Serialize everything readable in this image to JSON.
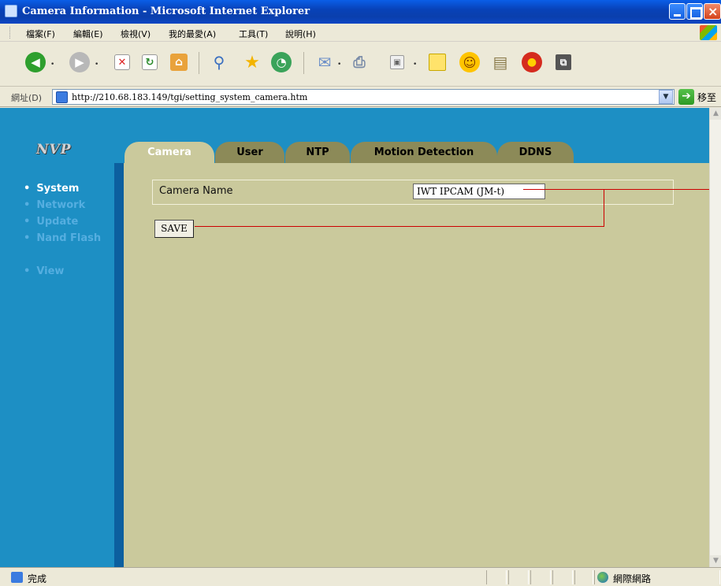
{
  "window": {
    "title": "Camera Information - Microsoft Internet Explorer"
  },
  "menu": [
    "檔案(F)",
    "編輯(E)",
    "檢視(V)",
    "我的最愛(A)",
    "工具(T)",
    "說明(H)"
  ],
  "toolbar": {
    "icons": [
      "back-icon",
      "forward-icon",
      "stop-icon",
      "refresh-icon",
      "home-icon",
      "search-icon",
      "favorites-icon",
      "history-icon",
      "mail-icon",
      "print-icon",
      "edit-icon",
      "discuss-icon",
      "messenger-icon",
      "research-icon",
      "media-icon",
      "extra-icon"
    ]
  },
  "address": {
    "label": "網址(D)",
    "url": "http://210.68.183.149/tgi/setting_system_camera.htm",
    "go_label": "移至"
  },
  "page": {
    "logo": "NVP",
    "sidebar": [
      {
        "label": "System",
        "active": true
      },
      {
        "label": "Network",
        "active": false
      },
      {
        "label": "Update",
        "active": false
      },
      {
        "label": "Nand Flash",
        "active": false
      },
      {
        "label": "View",
        "active": false
      }
    ],
    "tabs": [
      {
        "label": "Camera",
        "active": true
      },
      {
        "label": "User",
        "active": false
      },
      {
        "label": "NTP",
        "active": false
      },
      {
        "label": "Motion Detection",
        "active": false
      },
      {
        "label": "DDNS",
        "active": false
      }
    ],
    "form": {
      "camera_name_label": "Camera Name",
      "camera_name_value": "IWT IPCAM (JM-t)",
      "save_label": "SAVE"
    }
  },
  "status": {
    "text": "完成",
    "zone": "網際網路"
  },
  "colors": {
    "header_blue": "#1d8fc4",
    "panel_khaki": "#cac99c",
    "tab_inactive": "#8c8a58",
    "callout_red": "#cc0000"
  }
}
